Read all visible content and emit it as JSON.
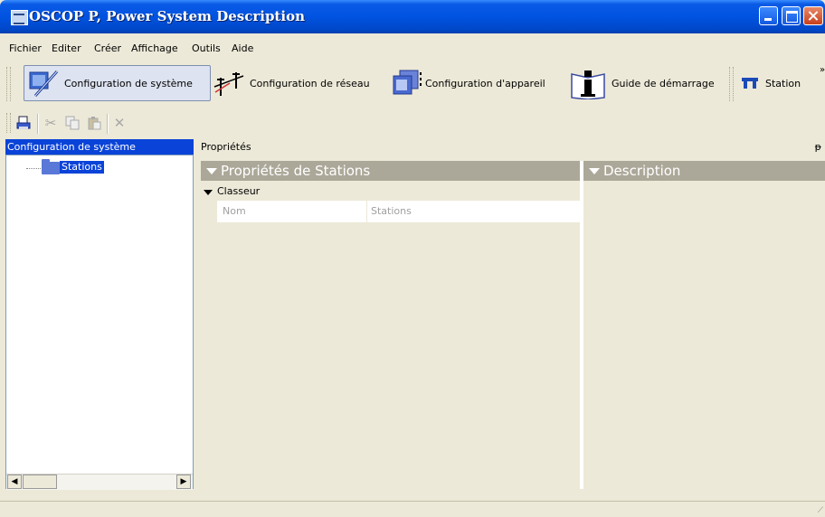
{
  "window": {
    "title": "OSCOP P, Power System Description"
  },
  "menu": [
    "Fichier",
    "Editer",
    "Créer",
    "Affichage",
    "Outils",
    "Aide"
  ],
  "toolbar": {
    "items": [
      {
        "label": "Configuration de système",
        "icon": "system-config-icon"
      },
      {
        "label": "Configuration de réseau",
        "icon": "network-config-icon"
      },
      {
        "label": "Configuration d'appareil",
        "icon": "device-config-icon"
      },
      {
        "label": "Guide de démarrage",
        "icon": "info-icon"
      },
      {
        "label": "Station",
        "icon": "station-icon"
      }
    ],
    "overflow": "»"
  },
  "edit_toolbar": {
    "icons": [
      "print-icon",
      "cut-icon",
      "copy-icon",
      "paste-icon",
      "delete-icon"
    ]
  },
  "tree": {
    "header": "Configuration de système",
    "items": [
      {
        "label": "Stations"
      }
    ]
  },
  "properties": {
    "header": "Propriétés",
    "pin": "ᵽ",
    "group_title": "Propriétés de Stations",
    "section": "Classeur",
    "rows": [
      {
        "key": "Nom",
        "value": "Stations"
      }
    ],
    "description_title": "Description"
  }
}
